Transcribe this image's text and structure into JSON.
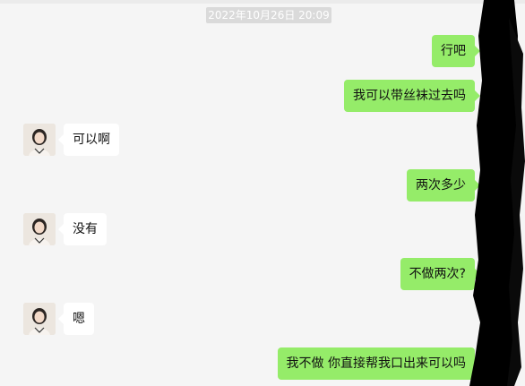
{
  "chat": {
    "timestamp": "2022年10月26日 20:09",
    "messages": [
      {
        "side": "right",
        "text": "行吧"
      },
      {
        "side": "right",
        "text": "我可以带丝袜过去吗"
      },
      {
        "side": "left",
        "text": "可以啊"
      },
      {
        "side": "right",
        "text": "两次多少"
      },
      {
        "side": "left",
        "text": "没有"
      },
      {
        "side": "right",
        "text": "不做两次?"
      },
      {
        "side": "left",
        "text": "嗯"
      },
      {
        "side": "right",
        "text": "我不做  你直接帮我口出来可以吗"
      }
    ]
  },
  "colors": {
    "background": "#f5f5f5",
    "self_bubble": "#95ec69",
    "other_bubble": "#ffffff",
    "timestamp_bg": "#dadada",
    "redaction": "#000000"
  },
  "icons": {
    "avatar": "contact-avatar-photo"
  }
}
